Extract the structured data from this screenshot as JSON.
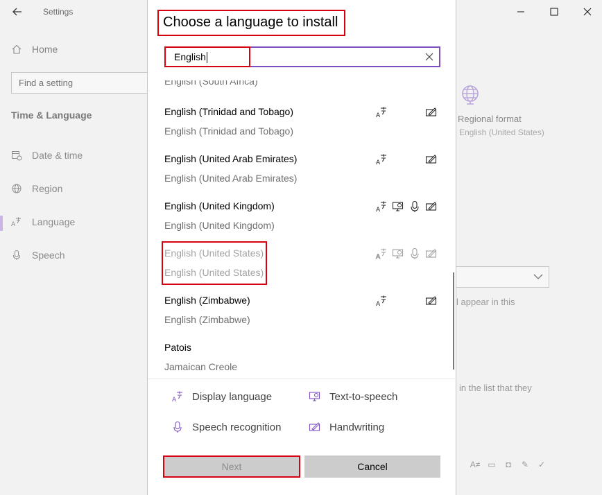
{
  "window": {
    "title": "Settings",
    "home_label": "Home",
    "search_placeholder": "Find a setting",
    "section_title": "Time & Language",
    "nav": [
      {
        "label": "Date & time",
        "icon": "calendar-clock-icon"
      },
      {
        "label": "Region",
        "icon": "globe-icon"
      },
      {
        "label": "Language",
        "icon": "language-icon",
        "active": true
      },
      {
        "label": "Speech",
        "icon": "microphone-icon"
      }
    ],
    "regional_format": {
      "label": "Regional format",
      "value": "English (United States)"
    },
    "bg_text_1": "l appear in this",
    "bg_text_2": "in the list that they"
  },
  "dialog": {
    "title": "Choose a language to install",
    "search_value": "English",
    "partial_item": "English (South Africa)",
    "languages": [
      {
        "name": "English (Trinidad and Tobago)",
        "native": "English (Trinidad and Tobago)",
        "features": [
          "display",
          "handwriting"
        ]
      },
      {
        "name": "English (United Arab Emirates)",
        "native": "English (United Arab Emirates)",
        "features": [
          "display",
          "handwriting"
        ]
      },
      {
        "name": "English (United Kingdom)",
        "native": "English (United Kingdom)",
        "features": [
          "display",
          "tts",
          "speech",
          "handwriting"
        ]
      },
      {
        "name": "English (United States)",
        "native": "English (United States)",
        "features": [
          "display",
          "tts",
          "speech",
          "handwriting"
        ],
        "dimmed": true
      },
      {
        "name": "English (Zimbabwe)",
        "native": "English (Zimbabwe)",
        "features": [
          "display",
          "handwriting"
        ]
      },
      {
        "name": "Patois",
        "native": "Jamaican Creole",
        "features": []
      }
    ],
    "legend": {
      "display": "Display language",
      "tts": "Text-to-speech",
      "speech": "Speech recognition",
      "handwriting": "Handwriting"
    },
    "buttons": {
      "next": "Next",
      "cancel": "Cancel"
    }
  },
  "colors": {
    "accent": "#7b4fbf",
    "highlight": "#d6000f",
    "button_bg": "#cccccc"
  }
}
